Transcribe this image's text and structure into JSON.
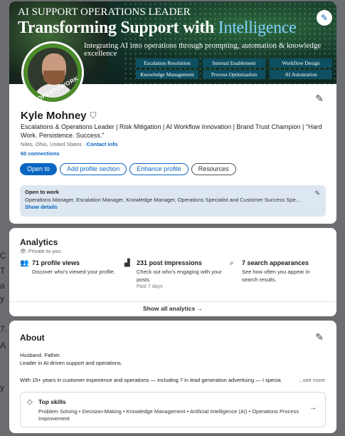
{
  "banner": {
    "line1": "AI SUPPORT OPERATIONS LEADER",
    "line2_main": "Transforming Support with ",
    "line2_highlight": "Intelligence",
    "line3": "Integrating AI into operations through prompting, automation & knowledge excellence",
    "chips": [
      "Escalation Resolution",
      "Internal Enablement",
      "Workflow Design",
      "Knowledge Management",
      "Process Optimization",
      "AI Automation"
    ],
    "edit_icon": "pencil-icon"
  },
  "profile": {
    "avatar_badge": "#OPENTOWORK",
    "name": "Kyle Mohney",
    "verify_icon": "shield-check-icon",
    "headline": "Escalations & Operations Leader | Risk Mitigation | AI Workflow Innovation | Brand Trust Champion | \"Hard Work. Persistence. Success.\"",
    "location": "Niles, Ohio, United States",
    "separator": " · ",
    "contact": "Contact info",
    "connections": "60 connections",
    "buttons": {
      "open_to": "Open to",
      "add_section": "Add profile section",
      "enhance": "Enhance profile",
      "resources": "Resources"
    }
  },
  "open_to_work": {
    "title": "Open to work",
    "roles": "Operations Manager, Escalation Manager, Knowledge Manager, Operations Specialist and Customer Success Spe...",
    "show_details": "Show details"
  },
  "analytics": {
    "title": "Analytics",
    "private": "Private to you",
    "metrics": [
      {
        "icon": "people-icon",
        "title": "71 profile views",
        "desc": "Discover who's viewed your profile.",
        "sub": ""
      },
      {
        "icon": "bar-chart-icon",
        "title": "231 post impressions",
        "desc": "Check out who's engaging with your posts.",
        "sub": "Past 7 days"
      },
      {
        "icon": "search-icon",
        "title": "7 search appearances",
        "desc": "See how often you appear in search results.",
        "sub": ""
      }
    ],
    "show_all": "Show all analytics →"
  },
  "about": {
    "title": "About",
    "line1": "Husband. Father.",
    "line2": "Leader in AI-driven support and operations.",
    "line3": "With 15+ years in customer experience and operations — including 7 in lead generation advertising — I specia",
    "see_more": "...see more",
    "skills": {
      "title": "Top skills",
      "list": "Problem Solving • Decision-Making • Knowledge Management • Artificial Intelligence (AI) • Operations Process Improvement",
      "arrow": "→"
    }
  },
  "backdrop": {
    "edge_chars": [
      "C",
      "T",
      "a",
      "y",
      "7.",
      "A",
      "y"
    ]
  }
}
